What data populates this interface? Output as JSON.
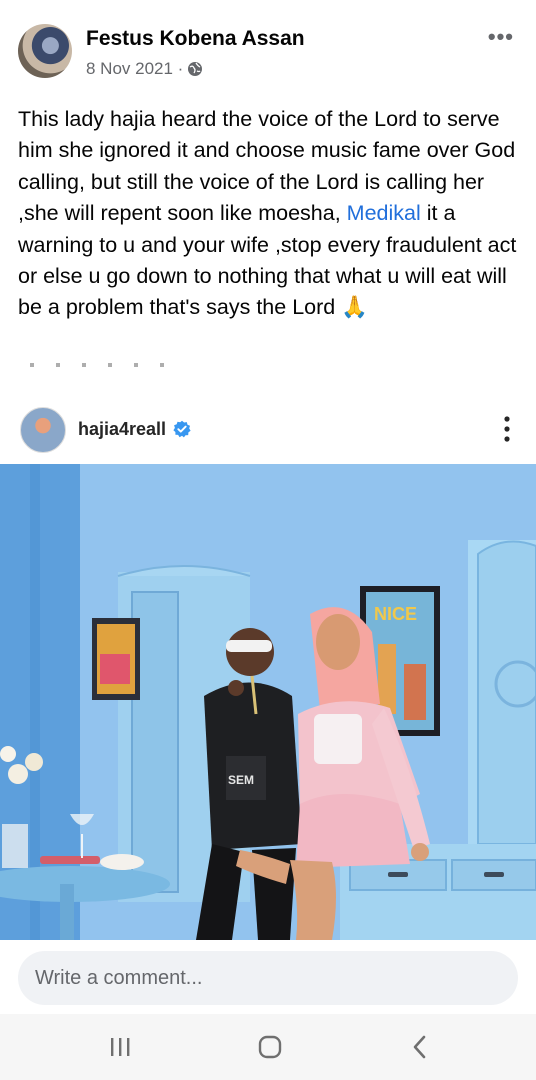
{
  "post": {
    "author": "Festus Kobena Assan",
    "date": "8 Nov 2021 · ",
    "audience_icon": "globe-icon",
    "more_icon": "more-horizontal-icon",
    "text_before_mention": "This lady hajia  heard the voice of the Lord to serve him she ignored it and choose music fame over God calling, but still the voice of the Lord is calling her ,she will repent soon like moesha, ",
    "mention": "Medikal",
    "text_after_mention": " it a warning to u and your wife ,stop every fraudulent act or else u go down to nothing that what u will eat will be a problem that's says the Lord ",
    "emoji": "🙏"
  },
  "shared_post": {
    "username": "hajia4reall",
    "verified_icon": "verified-badge-icon",
    "menu_icon": "kebab-menu-icon",
    "photo_text": {
      "poster": "NICE",
      "shirt": "SEM"
    }
  },
  "comment": {
    "placeholder": "Write a comment..."
  },
  "nav": {
    "recent": "recent-apps-icon",
    "home": "home-icon",
    "back": "back-icon"
  },
  "colors": {
    "link": "#216fdb",
    "secondary_text": "#65676b",
    "input_bg": "#f0f2f5",
    "verified": "#3897f0"
  }
}
